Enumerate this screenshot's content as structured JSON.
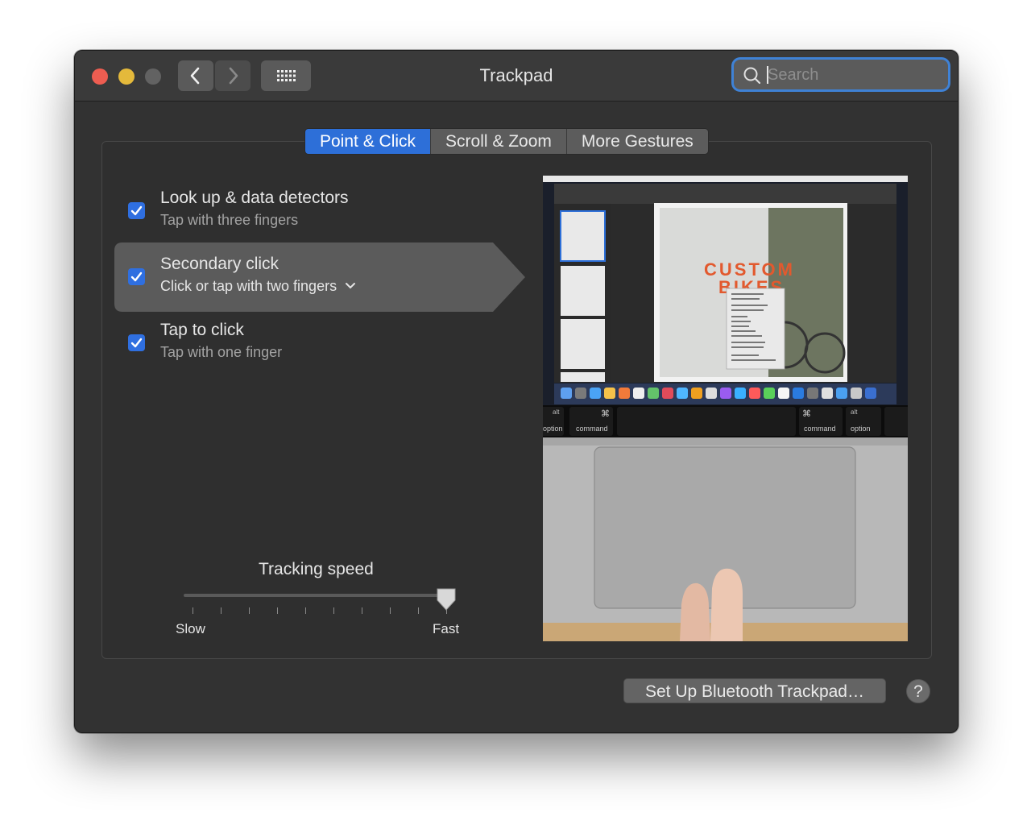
{
  "window": {
    "title": "Trackpad",
    "traffic_lights": {
      "close": "#ee5d51",
      "minimize": "#e4b93b",
      "zoom": "#626262"
    }
  },
  "toolbar": {
    "back_icon": "chevron-left-icon",
    "forward_icon": "chevron-right-icon",
    "show_all_icon": "grid-icon"
  },
  "search": {
    "placeholder": "Search",
    "value": ""
  },
  "tabs": [
    {
      "label": "Point & Click",
      "active": true
    },
    {
      "label": "Scroll & Zoom",
      "active": false
    },
    {
      "label": "More Gestures",
      "active": false
    }
  ],
  "options": [
    {
      "label": "Look up & data detectors",
      "sublabel": "Tap with three fingers",
      "checked": true,
      "selected": false
    },
    {
      "label": "Secondary click",
      "sublabel": "Click or tap with two fingers",
      "checked": true,
      "selected": true,
      "has_dropdown": true
    },
    {
      "label": "Tap to click",
      "sublabel": "Tap with one finger",
      "checked": true,
      "selected": false
    }
  ],
  "tracking_speed": {
    "label": "Tracking speed",
    "min_label": "Slow",
    "max_label": "Fast",
    "tick_count": 10,
    "value_fraction": 1.0
  },
  "preview": {
    "poster_text": "CUSTOM BIKES",
    "keys": [
      "option",
      "command",
      "command",
      "option"
    ],
    "key_alts": [
      "alt",
      "⌘",
      "⌘",
      "alt"
    ]
  },
  "footer": {
    "setup_button": "Set Up Bluetooth Trackpad…",
    "help_button": "?"
  },
  "colors": {
    "accent": "#2d6fd8",
    "window_bg": "#323232",
    "focus_ring": "#3f82d6"
  }
}
